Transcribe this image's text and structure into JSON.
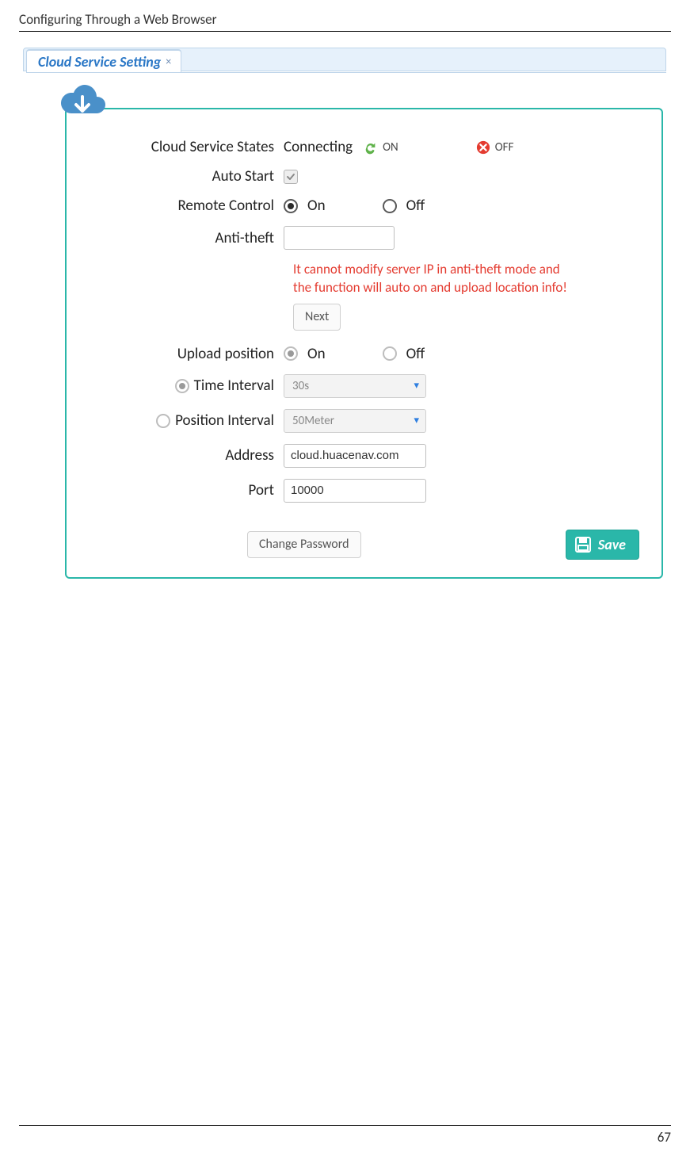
{
  "page": {
    "header": "Configuring Through a Web Browser",
    "number": "67"
  },
  "tab": {
    "title": "Cloud Service Setting",
    "close": "×"
  },
  "icons": {
    "cloud": "cloud-download-icon"
  },
  "form": {
    "states_label": "Cloud Service States",
    "states_value": "Connecting",
    "on_text": "ON",
    "off_text": "OFF",
    "auto_start_label": "Auto Start",
    "remote_control_label": "Remote Control",
    "remote_on": "On",
    "remote_off": "Off",
    "anti_theft_label": "Anti-theft",
    "anti_theft_value": "",
    "warn_text": "It cannot modify server IP in anti-theft mode and the function will auto on and upload location info!",
    "next_button": "Next",
    "upload_position_label": "Upload position",
    "upload_on": "On",
    "upload_off": "Off",
    "time_interval_label": "Time Interval",
    "time_interval_value": "30s",
    "position_interval_label": "Position Interval",
    "position_interval_value": "50Meter",
    "address_label": "Address",
    "address_value": "cloud.huacenav.com",
    "port_label": "Port",
    "port_value": "10000",
    "change_password": "Change Password",
    "save": "Save"
  }
}
